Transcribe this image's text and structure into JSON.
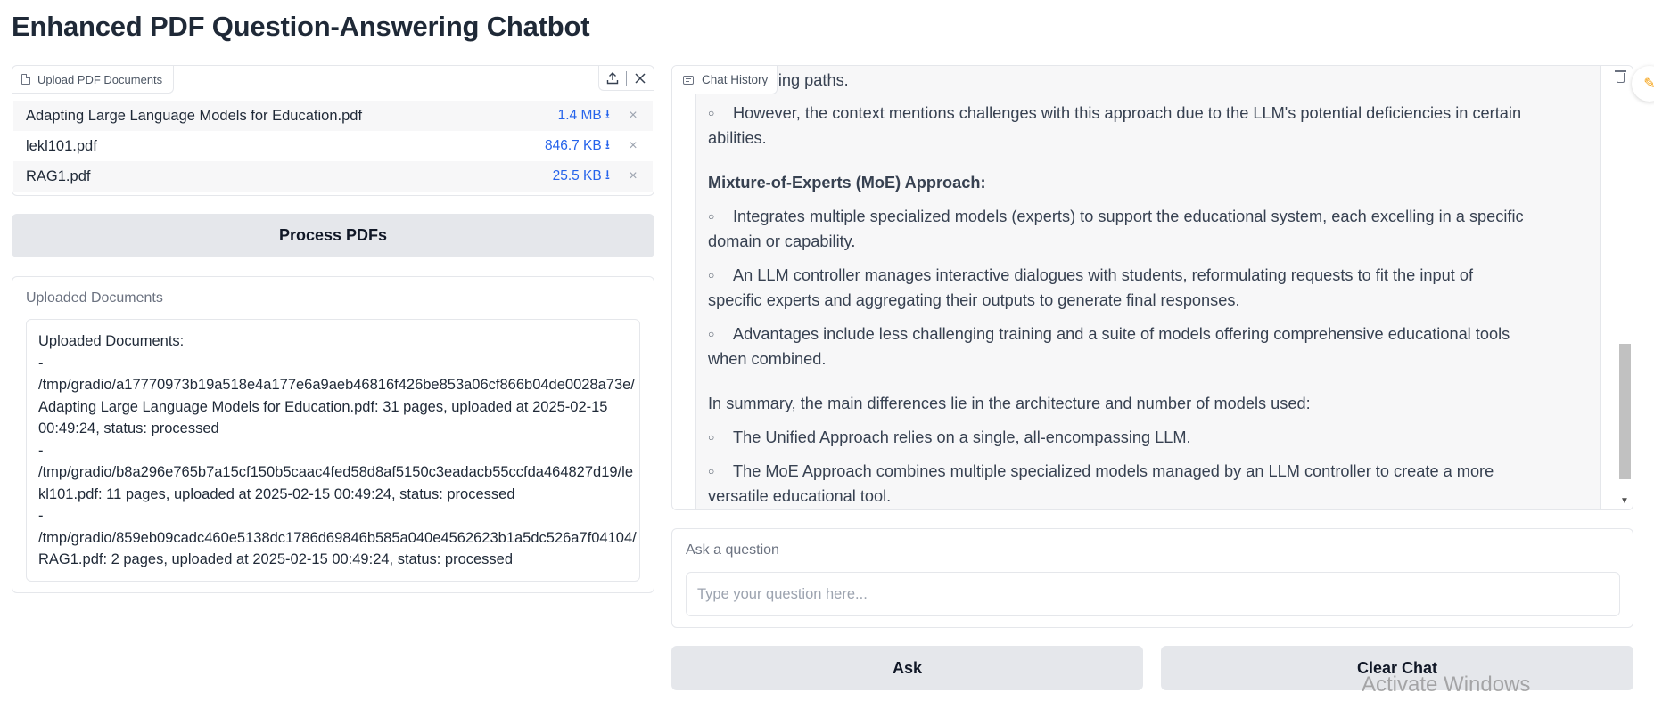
{
  "app": {
    "title": "Enhanced PDF Question-Answering Chatbot"
  },
  "upload": {
    "label": "Upload PDF Documents",
    "icon": "file-icon",
    "tools": {
      "upload_icon": "upload-icon",
      "close_icon": "close-icon"
    },
    "files": [
      {
        "name": "Adapting Large Language Models for Education.pdf",
        "size": "1.4 MB",
        "download": "⭳",
        "remove": "×"
      },
      {
        "name": "lekl101.pdf",
        "size": "846.7 KB",
        "download": "⭳",
        "remove": "×"
      },
      {
        "name": "RAG1.pdf",
        "size": "25.5 KB",
        "download": "⭳",
        "remove": "×"
      }
    ]
  },
  "process_button": "Process PDFs",
  "documents": {
    "label": "Uploaded Documents",
    "lines": [
      "Uploaded Documents:",
      "-",
      "/tmp/gradio/a17770973b19a518e4a177e6a9aeb46816f426be853a06cf866b04de0028a73e/",
      "Adapting Large Language Models for Education.pdf: 31 pages, uploaded at 2025-02-15",
      "00:49:24, status: processed",
      "-",
      "/tmp/gradio/b8a296e765b7a15cf150b5caac4fed58d8af5150c3eadacb55ccfda464827d19/le",
      "kl101.pdf: 11 pages, uploaded at 2025-02-15 00:49:24, status: processed",
      "-",
      "/tmp/gradio/859eb09cadc460e5138dc1786d69846b585a040e4562623b1a5dc526a7f04104/",
      "RAG1.pdf: 2 pages, uploaded at 2025-02-15 00:49:24, status: processed"
    ]
  },
  "chat": {
    "label": "Chat History",
    "icon": "chat-icon",
    "clear_icon": "trash-icon",
    "lines": {
      "l0": "ized learning paths.",
      "l1": "However, the context mentions challenges with this approach due to the LLM's potential deficiencies in certain",
      "l2": "abilities.",
      "h1": "Mixture-of-Experts (MoE) Approach:",
      "l3": "Integrates multiple specialized models (experts) to support the educational system, each excelling in a specific",
      "l4": "domain or capability.",
      "l5": "An LLM controller manages interactive dialogues with students, reformulating requests to fit the input of",
      "l6": "specific experts and aggregating their outputs to generate final responses.",
      "l7": "Advantages include less challenging training and a suite of models offering comprehensive educational tools",
      "l8": "when combined.",
      "l9": "In summary, the main differences lie in the architecture and number of models used:",
      "l10": "The Unified Approach relies on a single, all-encompassing LLM.",
      "l11": "The MoE Approach combines multiple specialized models managed by an LLM controller to create a more",
      "l12": "versatile educational tool."
    },
    "bullet": "○"
  },
  "ask": {
    "label": "Ask a question",
    "placeholder": "Type your question here..."
  },
  "buttons": {
    "ask": "Ask",
    "clear": "Clear Chat"
  },
  "watermark": "Activate Windows",
  "colors": {
    "accent": "#2563eb",
    "button_bg": "#e5e7eb",
    "chat_bg": "#f7f7f8"
  }
}
